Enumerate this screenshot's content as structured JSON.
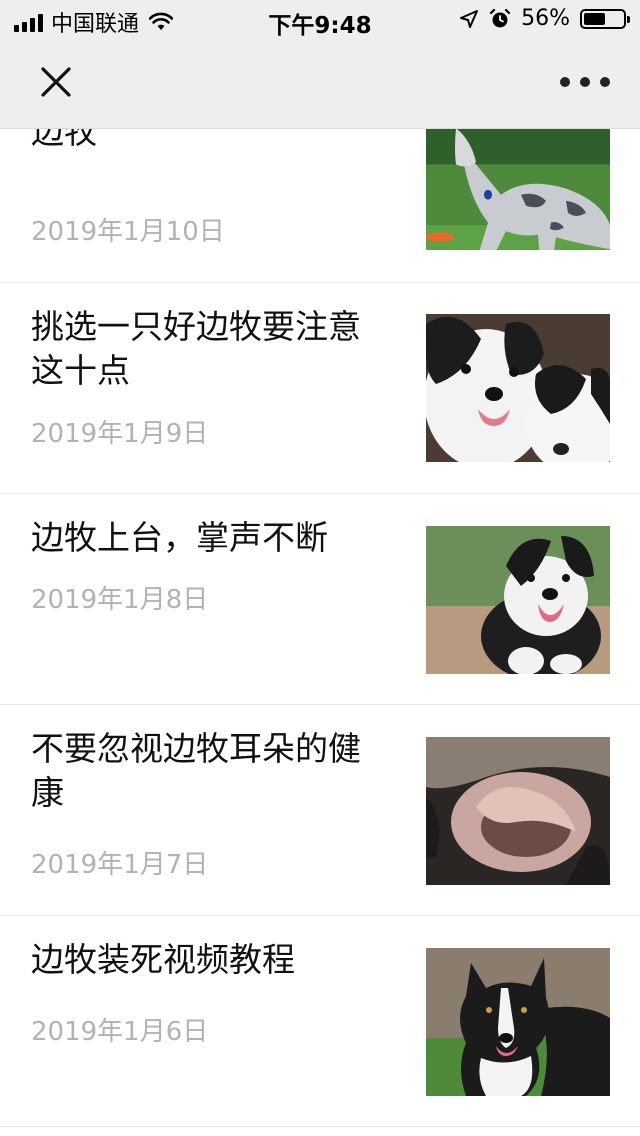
{
  "status_bar": {
    "carrier": "中国联通",
    "time": "下午9:48",
    "battery_percent": "56%",
    "battery_level": 0.56,
    "icons": [
      "signal-icon",
      "wifi-icon",
      "location-arrow-icon",
      "alarm-icon",
      "battery-icon"
    ]
  },
  "nav": {
    "close_icon": "close-icon",
    "more_icon": "more-dots-icon"
  },
  "articles": [
    {
      "title": "有这环境我也多养几只边牧",
      "title_visible": "边牧",
      "date": "2019年1月10日"
    },
    {
      "title": "挑选一只好边牧要注意这十点",
      "date": "2019年1月9日"
    },
    {
      "title": "边牧上台，掌声不断",
      "date": "2019年1月8日"
    },
    {
      "title": "不要忽视边牧耳朵的健康",
      "date": "2019年1月7日"
    },
    {
      "title": "边牧装死视频教程",
      "date": "2019年1月6日"
    }
  ],
  "colors": {
    "bar_bg": "#eeeeee",
    "title": "#111111",
    "date": "#b2b2b2",
    "divider": "#e6e6e6"
  }
}
